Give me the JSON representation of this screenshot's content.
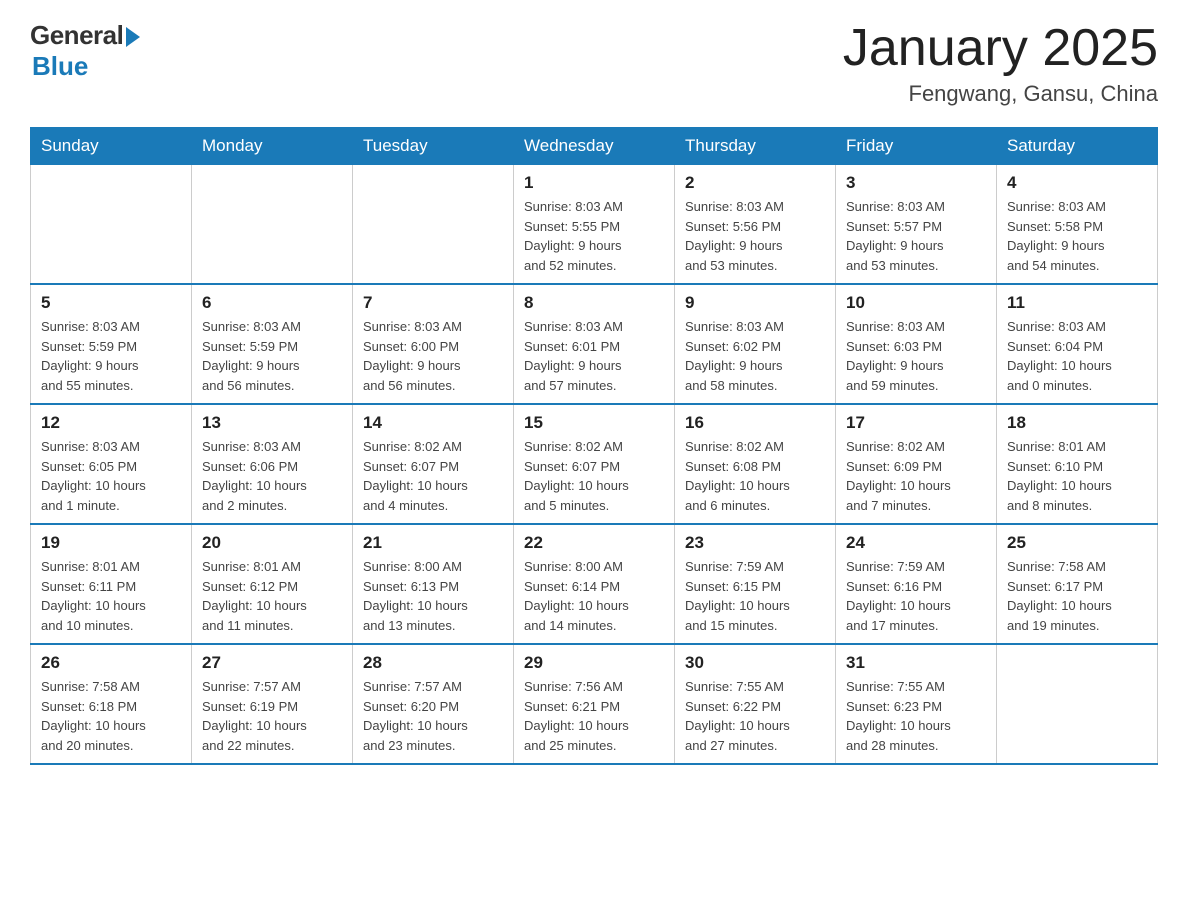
{
  "logo": {
    "general": "General",
    "blue": "Blue"
  },
  "title": "January 2025",
  "subtitle": "Fengwang, Gansu, China",
  "days": [
    "Sunday",
    "Monday",
    "Tuesday",
    "Wednesday",
    "Thursday",
    "Friday",
    "Saturday"
  ],
  "weeks": [
    [
      {
        "day": "",
        "info": ""
      },
      {
        "day": "",
        "info": ""
      },
      {
        "day": "",
        "info": ""
      },
      {
        "day": "1",
        "info": "Sunrise: 8:03 AM\nSunset: 5:55 PM\nDaylight: 9 hours\nand 52 minutes."
      },
      {
        "day": "2",
        "info": "Sunrise: 8:03 AM\nSunset: 5:56 PM\nDaylight: 9 hours\nand 53 minutes."
      },
      {
        "day": "3",
        "info": "Sunrise: 8:03 AM\nSunset: 5:57 PM\nDaylight: 9 hours\nand 53 minutes."
      },
      {
        "day": "4",
        "info": "Sunrise: 8:03 AM\nSunset: 5:58 PM\nDaylight: 9 hours\nand 54 minutes."
      }
    ],
    [
      {
        "day": "5",
        "info": "Sunrise: 8:03 AM\nSunset: 5:59 PM\nDaylight: 9 hours\nand 55 minutes."
      },
      {
        "day": "6",
        "info": "Sunrise: 8:03 AM\nSunset: 5:59 PM\nDaylight: 9 hours\nand 56 minutes."
      },
      {
        "day": "7",
        "info": "Sunrise: 8:03 AM\nSunset: 6:00 PM\nDaylight: 9 hours\nand 56 minutes."
      },
      {
        "day": "8",
        "info": "Sunrise: 8:03 AM\nSunset: 6:01 PM\nDaylight: 9 hours\nand 57 minutes."
      },
      {
        "day": "9",
        "info": "Sunrise: 8:03 AM\nSunset: 6:02 PM\nDaylight: 9 hours\nand 58 minutes."
      },
      {
        "day": "10",
        "info": "Sunrise: 8:03 AM\nSunset: 6:03 PM\nDaylight: 9 hours\nand 59 minutes."
      },
      {
        "day": "11",
        "info": "Sunrise: 8:03 AM\nSunset: 6:04 PM\nDaylight: 10 hours\nand 0 minutes."
      }
    ],
    [
      {
        "day": "12",
        "info": "Sunrise: 8:03 AM\nSunset: 6:05 PM\nDaylight: 10 hours\nand 1 minute."
      },
      {
        "day": "13",
        "info": "Sunrise: 8:03 AM\nSunset: 6:06 PM\nDaylight: 10 hours\nand 2 minutes."
      },
      {
        "day": "14",
        "info": "Sunrise: 8:02 AM\nSunset: 6:07 PM\nDaylight: 10 hours\nand 4 minutes."
      },
      {
        "day": "15",
        "info": "Sunrise: 8:02 AM\nSunset: 6:07 PM\nDaylight: 10 hours\nand 5 minutes."
      },
      {
        "day": "16",
        "info": "Sunrise: 8:02 AM\nSunset: 6:08 PM\nDaylight: 10 hours\nand 6 minutes."
      },
      {
        "day": "17",
        "info": "Sunrise: 8:02 AM\nSunset: 6:09 PM\nDaylight: 10 hours\nand 7 minutes."
      },
      {
        "day": "18",
        "info": "Sunrise: 8:01 AM\nSunset: 6:10 PM\nDaylight: 10 hours\nand 8 minutes."
      }
    ],
    [
      {
        "day": "19",
        "info": "Sunrise: 8:01 AM\nSunset: 6:11 PM\nDaylight: 10 hours\nand 10 minutes."
      },
      {
        "day": "20",
        "info": "Sunrise: 8:01 AM\nSunset: 6:12 PM\nDaylight: 10 hours\nand 11 minutes."
      },
      {
        "day": "21",
        "info": "Sunrise: 8:00 AM\nSunset: 6:13 PM\nDaylight: 10 hours\nand 13 minutes."
      },
      {
        "day": "22",
        "info": "Sunrise: 8:00 AM\nSunset: 6:14 PM\nDaylight: 10 hours\nand 14 minutes."
      },
      {
        "day": "23",
        "info": "Sunrise: 7:59 AM\nSunset: 6:15 PM\nDaylight: 10 hours\nand 15 minutes."
      },
      {
        "day": "24",
        "info": "Sunrise: 7:59 AM\nSunset: 6:16 PM\nDaylight: 10 hours\nand 17 minutes."
      },
      {
        "day": "25",
        "info": "Sunrise: 7:58 AM\nSunset: 6:17 PM\nDaylight: 10 hours\nand 19 minutes."
      }
    ],
    [
      {
        "day": "26",
        "info": "Sunrise: 7:58 AM\nSunset: 6:18 PM\nDaylight: 10 hours\nand 20 minutes."
      },
      {
        "day": "27",
        "info": "Sunrise: 7:57 AM\nSunset: 6:19 PM\nDaylight: 10 hours\nand 22 minutes."
      },
      {
        "day": "28",
        "info": "Sunrise: 7:57 AM\nSunset: 6:20 PM\nDaylight: 10 hours\nand 23 minutes."
      },
      {
        "day": "29",
        "info": "Sunrise: 7:56 AM\nSunset: 6:21 PM\nDaylight: 10 hours\nand 25 minutes."
      },
      {
        "day": "30",
        "info": "Sunrise: 7:55 AM\nSunset: 6:22 PM\nDaylight: 10 hours\nand 27 minutes."
      },
      {
        "day": "31",
        "info": "Sunrise: 7:55 AM\nSunset: 6:23 PM\nDaylight: 10 hours\nand 28 minutes."
      },
      {
        "day": "",
        "info": ""
      }
    ]
  ]
}
